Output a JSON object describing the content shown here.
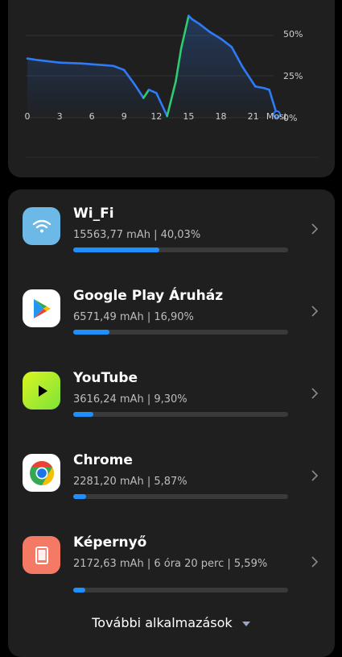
{
  "chart": {
    "y_labels": [
      "50%",
      "25%",
      "0%"
    ],
    "x_labels": [
      "0",
      "3",
      "6",
      "9",
      "12",
      "15",
      "18",
      "21",
      "Most"
    ]
  },
  "chart_data": {
    "type": "line",
    "x": [
      0,
      1,
      3,
      5,
      7,
      8,
      9,
      10,
      10.8,
      11.3,
      12,
      13,
      13.8,
      14.3,
      15,
      15.3,
      16,
      17,
      18,
      19,
      20,
      20.8,
      21.2,
      22,
      22.5,
      23.2
    ],
    "y": [
      36,
      35,
      33.5,
      33,
      32,
      31.5,
      29,
      20,
      12,
      17,
      15,
      1,
      22,
      42,
      62,
      60,
      57,
      52,
      48,
      43,
      31,
      23,
      19,
      18,
      17,
      2
    ],
    "y_ticks": [
      "0%",
      "25%",
      "50%"
    ],
    "x_ticks": [
      "0",
      "3",
      "6",
      "9",
      "12",
      "15",
      "18",
      "21",
      "Most"
    ],
    "ylim": [
      0,
      70
    ],
    "series_colors": {
      "line": "#2f7bf6",
      "charging": "#2ecc71"
    },
    "grid": true
  },
  "apps": [
    {
      "name": "Wi_Fi",
      "stats": "15563,77 mAh | 40,03%",
      "percent": 40.03,
      "icon": "wifi-icon",
      "color": "#6cb8e6"
    },
    {
      "name": "Google Play Áruház",
      "stats": "6571,49 mAh | 16,90%",
      "percent": 16.9,
      "icon": "google-play-icon",
      "color": "#ffffff"
    },
    {
      "name": "YouTube",
      "stats": "3616,24 mAh | 9,30%",
      "percent": 9.3,
      "icon": "youtube-icon",
      "color": "#c6f02e"
    },
    {
      "name": "Chrome",
      "stats": "2281,20 mAh | 5,87%",
      "percent": 5.87,
      "icon": "chrome-icon",
      "color": "#ffffff"
    },
    {
      "name": "Képernyő",
      "stats": "2172,63 mAh | 6 óra 20 perc | 5,59%",
      "percent": 5.59,
      "icon": "screen-icon",
      "color": "#f47a66"
    }
  ],
  "more_label": "További alkalmazások"
}
